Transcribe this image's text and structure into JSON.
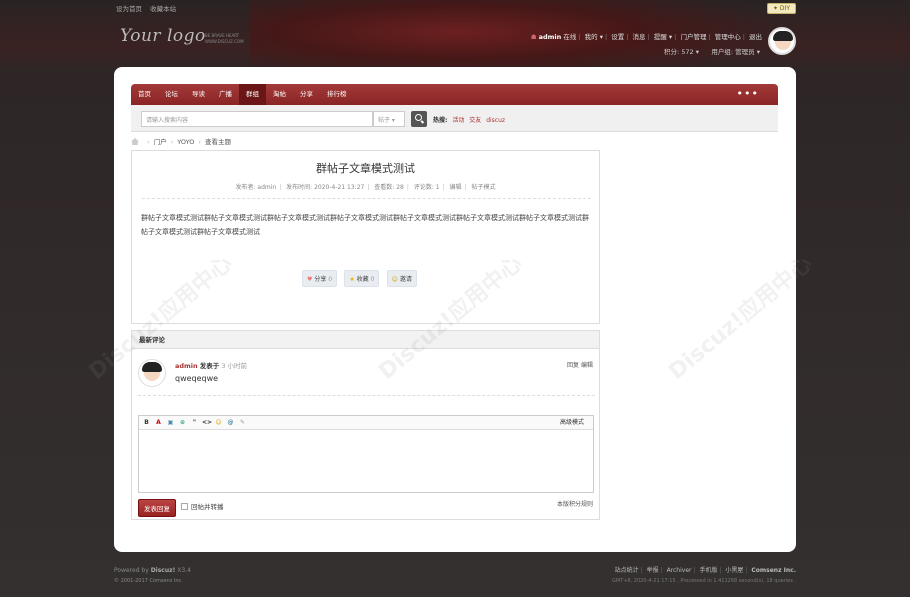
{
  "topbar": {
    "set_home": "设为首页",
    "bookmark": "收藏本站",
    "diy": "✦ DIY"
  },
  "logo": {
    "text": "Your logo",
    "sub1": "BE BRAVE HEART",
    "sub2": "WWW.DISCUZ.COM"
  },
  "user": {
    "name": "admin",
    "online": "在线",
    "mine": "我的",
    "settings": "设置",
    "messages": "消息",
    "remind": "提醒",
    "portal_manage": "门户管理",
    "admin_center": "管理中心",
    "logout": "退出",
    "points": "积分: 572",
    "group": "用户组: 管理员"
  },
  "nav": {
    "items": [
      "首页",
      "论坛",
      "导读",
      "广播",
      "群组",
      "淘帖",
      "分享",
      "排行榜"
    ],
    "active": "群组",
    "more": "•••"
  },
  "search": {
    "placeholder": "请输入搜索内容",
    "type": "帖子",
    "hot_label": "热搜:",
    "hot": [
      "活动",
      "交友",
      "discuz"
    ]
  },
  "breadcrumb": [
    "门户",
    "YOYO",
    "查看主题"
  ],
  "post": {
    "title": "群帖子文章模式测试",
    "author": "发布者: admin",
    "time": "发布时间: 2020-4-21 13:27",
    "views": "查看数: 28",
    "comments": "评论数: 1",
    "edit": "编辑",
    "mode": "帖子模式",
    "body": "群帖子文章模式测试群帖子文章模式测试群帖子文章模式测试群帖子文章模式测试群帖子文章模式测试群帖子文章模式测试群帖子文章模式测试群帖子文章模式测试群帖子文章模式测试",
    "share": "分享",
    "share_count": "0",
    "fav": "收藏",
    "fav_count": "0",
    "invite": "邀请"
  },
  "comments": {
    "header": "最新评论",
    "user": "admin",
    "posted": "发表于",
    "time": "3 小时前",
    "text": "qweqeqwe",
    "reply": "回复",
    "edit": "编辑"
  },
  "editor": {
    "advanced": "高级模式",
    "submit": "发表回复",
    "checkbox": "回帖并转播",
    "rules": "本版积分规则"
  },
  "footer": {
    "powered": "Powered by",
    "brand": "Discuz!",
    "version": "X3.4",
    "copyright": "© 2001-2017 Comsenz Inc.",
    "links": [
      "站点统计",
      "举报",
      "Archiver",
      "手机版",
      "小黑屋"
    ],
    "company": "Comsenz Inc.",
    "gmt": "GMT+8, 2020-4-21 17:15 , Processed in 1.411268 second(s), 18 queries ."
  }
}
